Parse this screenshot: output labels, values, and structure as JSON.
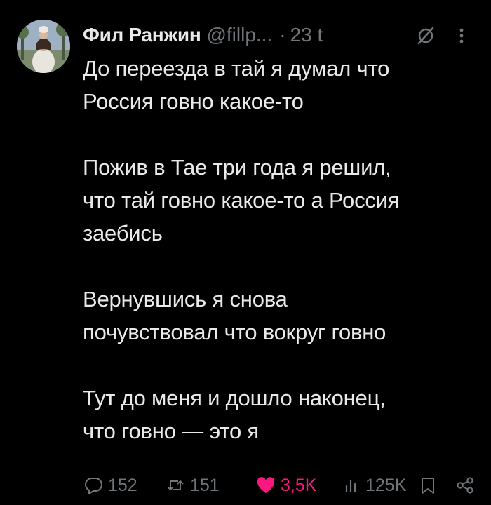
{
  "author": {
    "name": "Фил Ранжин",
    "handle": "@fillp...",
    "separator": "·",
    "time": "23 t"
  },
  "tweet": {
    "paragraphs": [
      "До переезда в тай я думал что\nРоссия говно какое-то",
      "Пожив в Тае три года я решил,\nчто тай говно какое-то а Россия\nзаебись",
      "Вернувшись я снова\nпочувствовал что вокруг говно",
      "Тут до меня и дошло наконец,\nчто говно — это я"
    ]
  },
  "actions": {
    "replies": "152",
    "retweets": "151",
    "likes": "3,5K",
    "views": "125K"
  },
  "icons": [
    "avatar",
    "grok-icon",
    "more-icon",
    "reply-icon",
    "retweet-icon",
    "heart-icon",
    "views-icon",
    "bookmark-icon",
    "share-icon"
  ],
  "colors": {
    "background": "#000000",
    "text": "#e7e9ea",
    "muted": "#71767b",
    "like": "#f91880"
  }
}
